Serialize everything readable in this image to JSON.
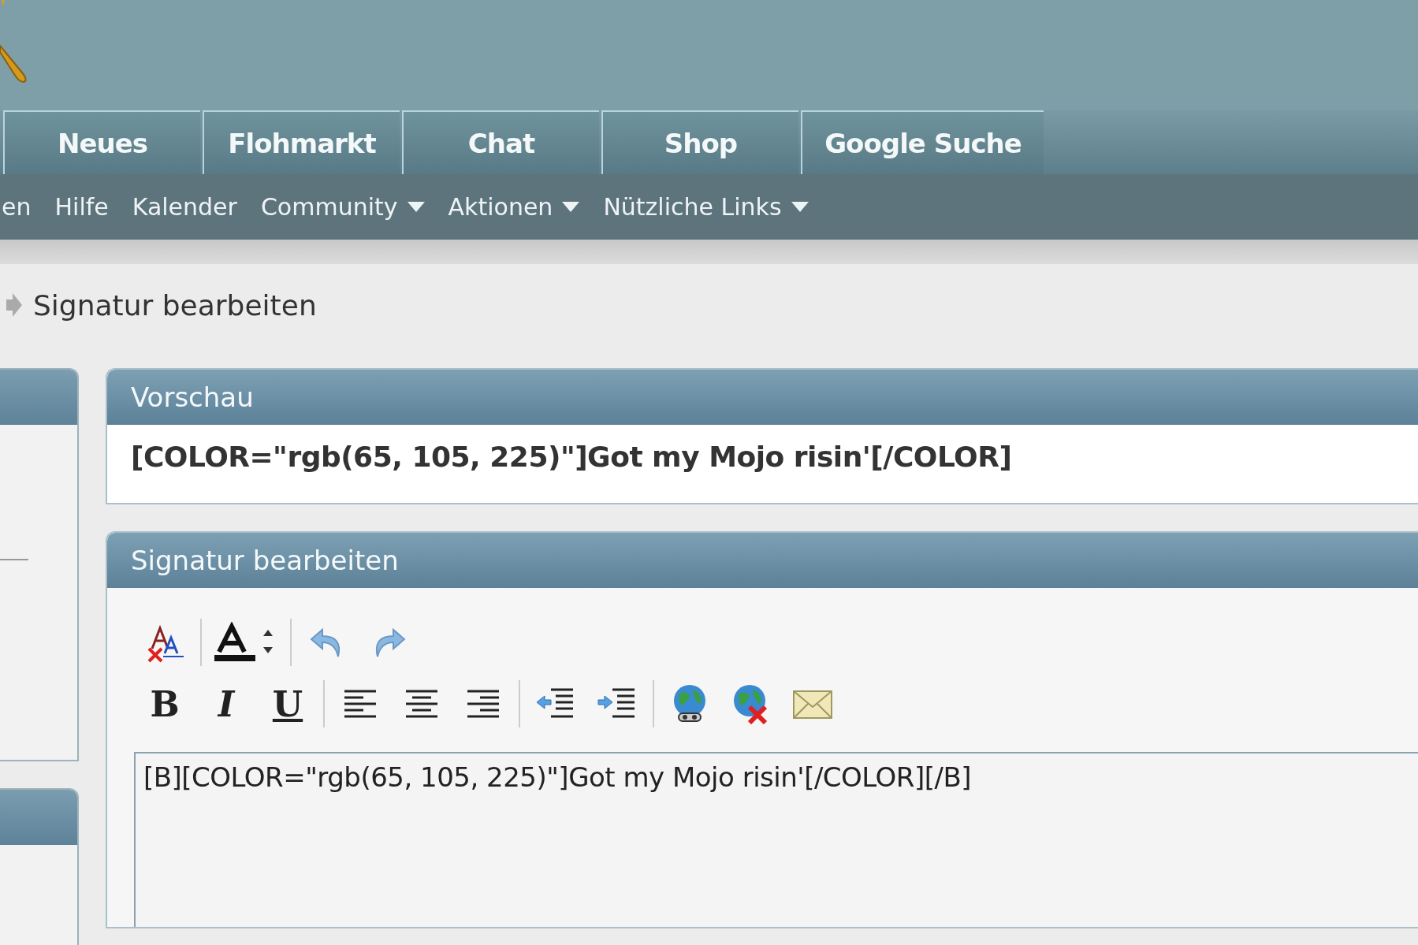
{
  "tabs": [
    {
      "label": "Neues"
    },
    {
      "label": "Flohmarkt"
    },
    {
      "label": "Chat"
    },
    {
      "label": "Shop"
    },
    {
      "label": "Google Suche"
    }
  ],
  "subnav": [
    {
      "label": "en",
      "has_menu": false
    },
    {
      "label": "Hilfe",
      "has_menu": false
    },
    {
      "label": "Kalender",
      "has_menu": false
    },
    {
      "label": "Community",
      "has_menu": true
    },
    {
      "label": "Aktionen",
      "has_menu": true
    },
    {
      "label": "Nützliche Links",
      "has_menu": true
    }
  ],
  "breadcrumb": {
    "text": "Signatur bearbeiten"
  },
  "preview": {
    "title": "Vorschau",
    "text": "[COLOR=\"rgb(65, 105, 225)\"]Got my Mojo risin'[/COLOR]"
  },
  "editor": {
    "title": "Signatur bearbeiten",
    "toolbar": [
      [
        {
          "kind": "remove-format"
        },
        {
          "kind": "separator"
        },
        {
          "kind": "font-color"
        },
        {
          "kind": "separator"
        },
        {
          "kind": "undo"
        },
        {
          "kind": "redo"
        }
      ],
      [
        {
          "kind": "bold",
          "label": "B"
        },
        {
          "kind": "italic",
          "label": "I"
        },
        {
          "kind": "underline",
          "label": "U"
        },
        {
          "kind": "separator"
        },
        {
          "kind": "align-left"
        },
        {
          "kind": "align-center"
        },
        {
          "kind": "align-right"
        },
        {
          "kind": "separator"
        },
        {
          "kind": "outdent"
        },
        {
          "kind": "indent"
        },
        {
          "kind": "separator"
        },
        {
          "kind": "link"
        },
        {
          "kind": "unlink"
        },
        {
          "kind": "email"
        }
      ]
    ],
    "value": "[B][COLOR=\"rgb(65, 105, 225)\"]Got my Mojo risin'[/COLOR][/B]"
  }
}
